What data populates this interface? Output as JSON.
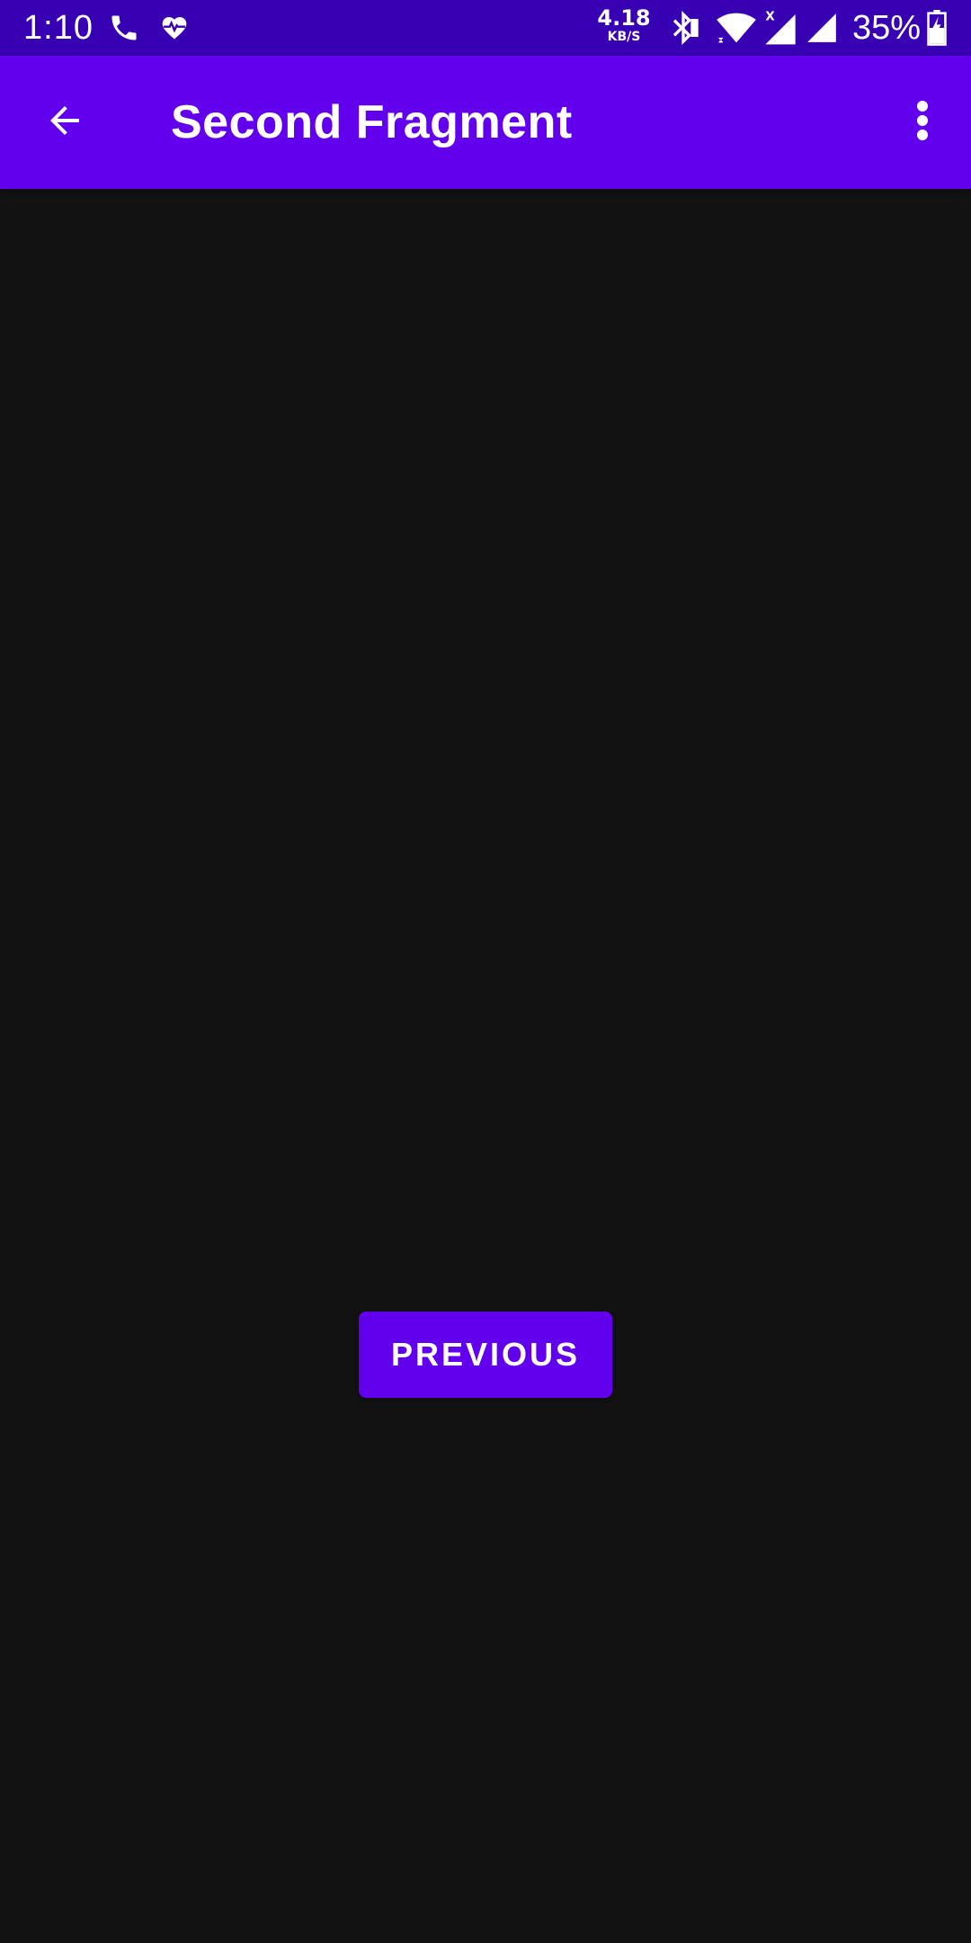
{
  "status_bar": {
    "time": "1:10",
    "net_speed_value": "4.18",
    "net_speed_unit": "KB/S",
    "battery_percent": "35%",
    "icons": [
      "phone-icon",
      "health-heart-icon",
      "bluetooth-icon",
      "wifi-icon",
      "signal-icon",
      "signal-icon",
      "battery-charging-icon"
    ],
    "background_color": "#3700b3"
  },
  "app_bar": {
    "title": "Second Fragment",
    "background_color": "#6200ee",
    "navigation_icon": "arrow-back-icon",
    "overflow_icon": "more-vert-icon"
  },
  "content": {
    "background_color": "#121212",
    "previous_button_label": "PREVIOUS",
    "button_color": "#6200ee"
  }
}
